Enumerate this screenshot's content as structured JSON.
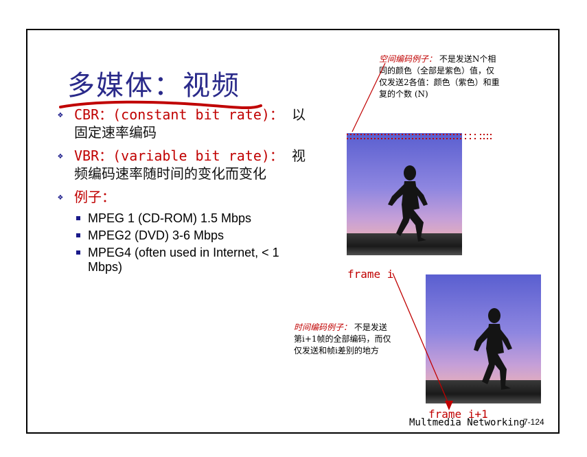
{
  "slide": {
    "title": "多媒体：视频",
    "bullets": [
      {
        "label": "CBR：(constant bit rate)：",
        "text": "以固定速率编码"
      },
      {
        "label": "VBR：(variable bit rate)：",
        "text": "视频编码速率随时间的变化而变化"
      },
      {
        "label": "例子：",
        "text": ""
      }
    ],
    "examples": [
      "MPEG 1 (CD-ROM) 1.5 Mbps",
      "MPEG2 (DVD) 3-6 Mbps",
      "MPEG4 (often used in Internet, < 1 Mbps)"
    ],
    "spatial_note": {
      "label": "空间编码例子：",
      "line1": "不是发送N个相",
      "line2": "同的颜色（全部是紫色）值，仅",
      "line3": "仅发送2各值：颜色（紫色）和重",
      "line4": "复的个数 (N)"
    },
    "temporal_note": {
      "label": "时间编码例子：",
      "line1": "不是发送",
      "line2": "第i+1帧的全部编码，而仅",
      "line3": "仅发送和帧i差别的地方"
    },
    "frame_i_label": "frame i",
    "frame_i1_label": "frame i+1",
    "footer_title": "Multmedia Networking",
    "page_number": "7-124"
  },
  "colors": {
    "title": "#2a2a8a",
    "accent_red": "#c00000",
    "bullet": "#1a1a8a"
  }
}
